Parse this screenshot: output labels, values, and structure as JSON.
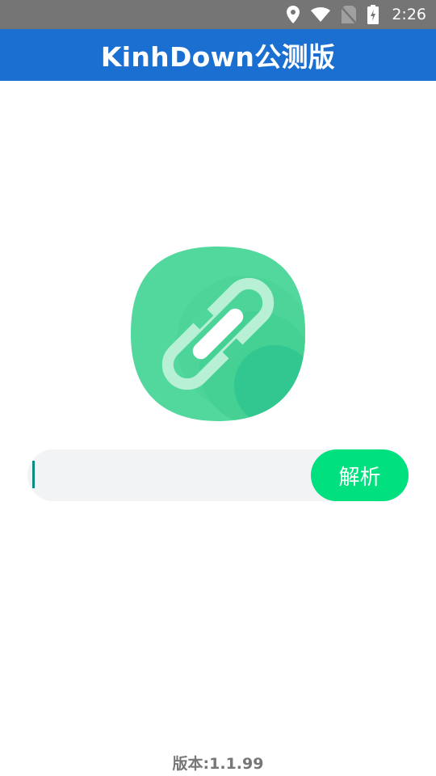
{
  "status_bar": {
    "time": "2:26",
    "icons": [
      "location-icon",
      "wifi-icon",
      "no-sim-icon",
      "battery-charging-icon"
    ]
  },
  "app_bar": {
    "title": "KinhDown公测版",
    "color": "#1a6fd0"
  },
  "logo": {
    "icon": "link-icon",
    "colors": [
      "#52d89c",
      "#2fc48f"
    ]
  },
  "search": {
    "value": "",
    "placeholder": ""
  },
  "parse_button": {
    "label": "解析",
    "color": "#00e07e"
  },
  "footer": {
    "version_text": "版本:1.1.99"
  }
}
